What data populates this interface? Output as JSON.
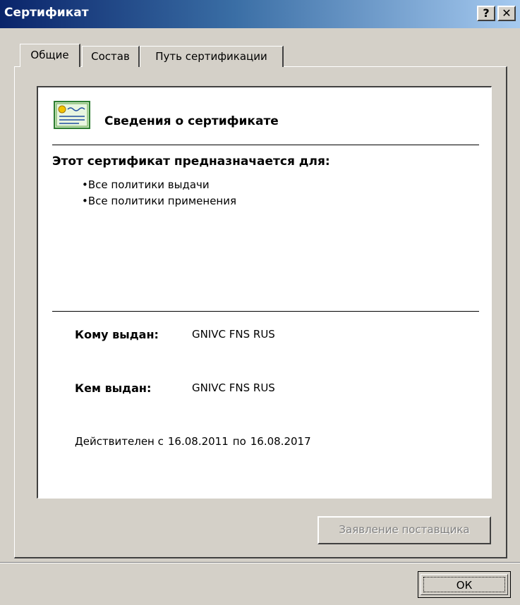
{
  "window": {
    "title": "Сертификат",
    "help_label": "?",
    "close_label": "✕"
  },
  "tabs": [
    {
      "label": "Общие",
      "active": true
    },
    {
      "label": "Состав",
      "active": false
    },
    {
      "label": "Путь сертификации",
      "active": false
    }
  ],
  "cert_info": {
    "heading": "Сведения о сертификате",
    "purpose_title": "Этот сертификат предназначается для:",
    "purposes": [
      "•Все политики выдачи",
      "•Все политики применения"
    ],
    "issued_to_label": "Кому выдан:",
    "issued_to": "GNIVC FNS RUS",
    "issued_by_label": "Кем выдан:",
    "issued_by": "GNIVC FNS RUS",
    "valid_from_label": "Действителен с",
    "valid_from": "16.08.2011",
    "valid_to_label": "по",
    "valid_to": "16.08.2017"
  },
  "buttons": {
    "issuer_statement": "Заявление поставщика",
    "ok": "ОК"
  },
  "colors": {
    "titlebar_start": "#0a246a",
    "titlebar_end": "#a6caf0",
    "face": "#d4d0c8"
  }
}
